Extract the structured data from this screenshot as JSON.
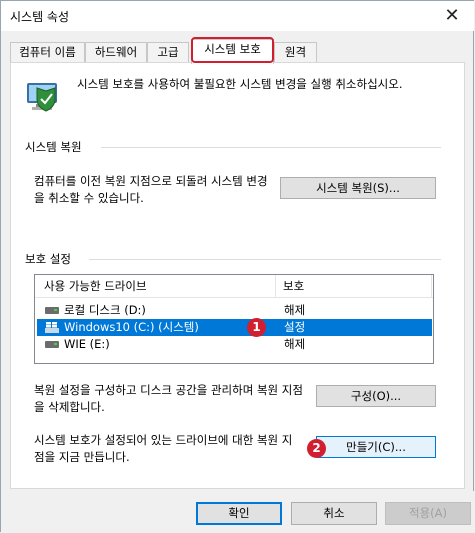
{
  "window": {
    "title": "시스템 속성",
    "close_glyph": "✕"
  },
  "tabs": [
    {
      "label": "컴퓨터 이름"
    },
    {
      "label": "하드웨어"
    },
    {
      "label": "고급"
    },
    {
      "label": "시스템 보호"
    },
    {
      "label": "원격"
    }
  ],
  "active_tab": "시스템 보호",
  "description": "시스템 보호를 사용하여 불필요한 시스템 변경을 실행 취소하십시오.",
  "restore": {
    "title": "시스템 복원",
    "text": "컴퓨터를 이전 복원 지점으로 되돌려 시스템 변경을 취소할 수 있습니다.",
    "button": "시스템 복원(S)..."
  },
  "protection": {
    "title": "보호 설정",
    "columns": [
      "사용 가능한 드라이브",
      "보호"
    ],
    "drives": [
      {
        "name": "로컬 디스크 (D:)",
        "protection": "해제",
        "icon": "drive-icon",
        "selected": false
      },
      {
        "name": "Windows10 (C:) (시스템)",
        "protection": "설정",
        "icon": "windows-drive-icon",
        "selected": true
      },
      {
        "name": "WIE (E:)",
        "protection": "해제",
        "icon": "drive-icon",
        "selected": false
      }
    ],
    "configure_text": "복원 설정을 구성하고 디스크 공간을 관리하며 복원 지점을 삭제합니다.",
    "configure_button": "구성(O)...",
    "create_text": "시스템 보호가 설정되어 있는 드라이브에 대한 복원 지점을 지금 만듭니다.",
    "create_button": "만들기(C)..."
  },
  "annotations": [
    "1",
    "2"
  ],
  "footer": {
    "ok": "확인",
    "cancel": "취소",
    "apply": "적용(A)"
  },
  "colors": {
    "accent": "#0078d7",
    "highlight_red": "#d21f2f"
  }
}
